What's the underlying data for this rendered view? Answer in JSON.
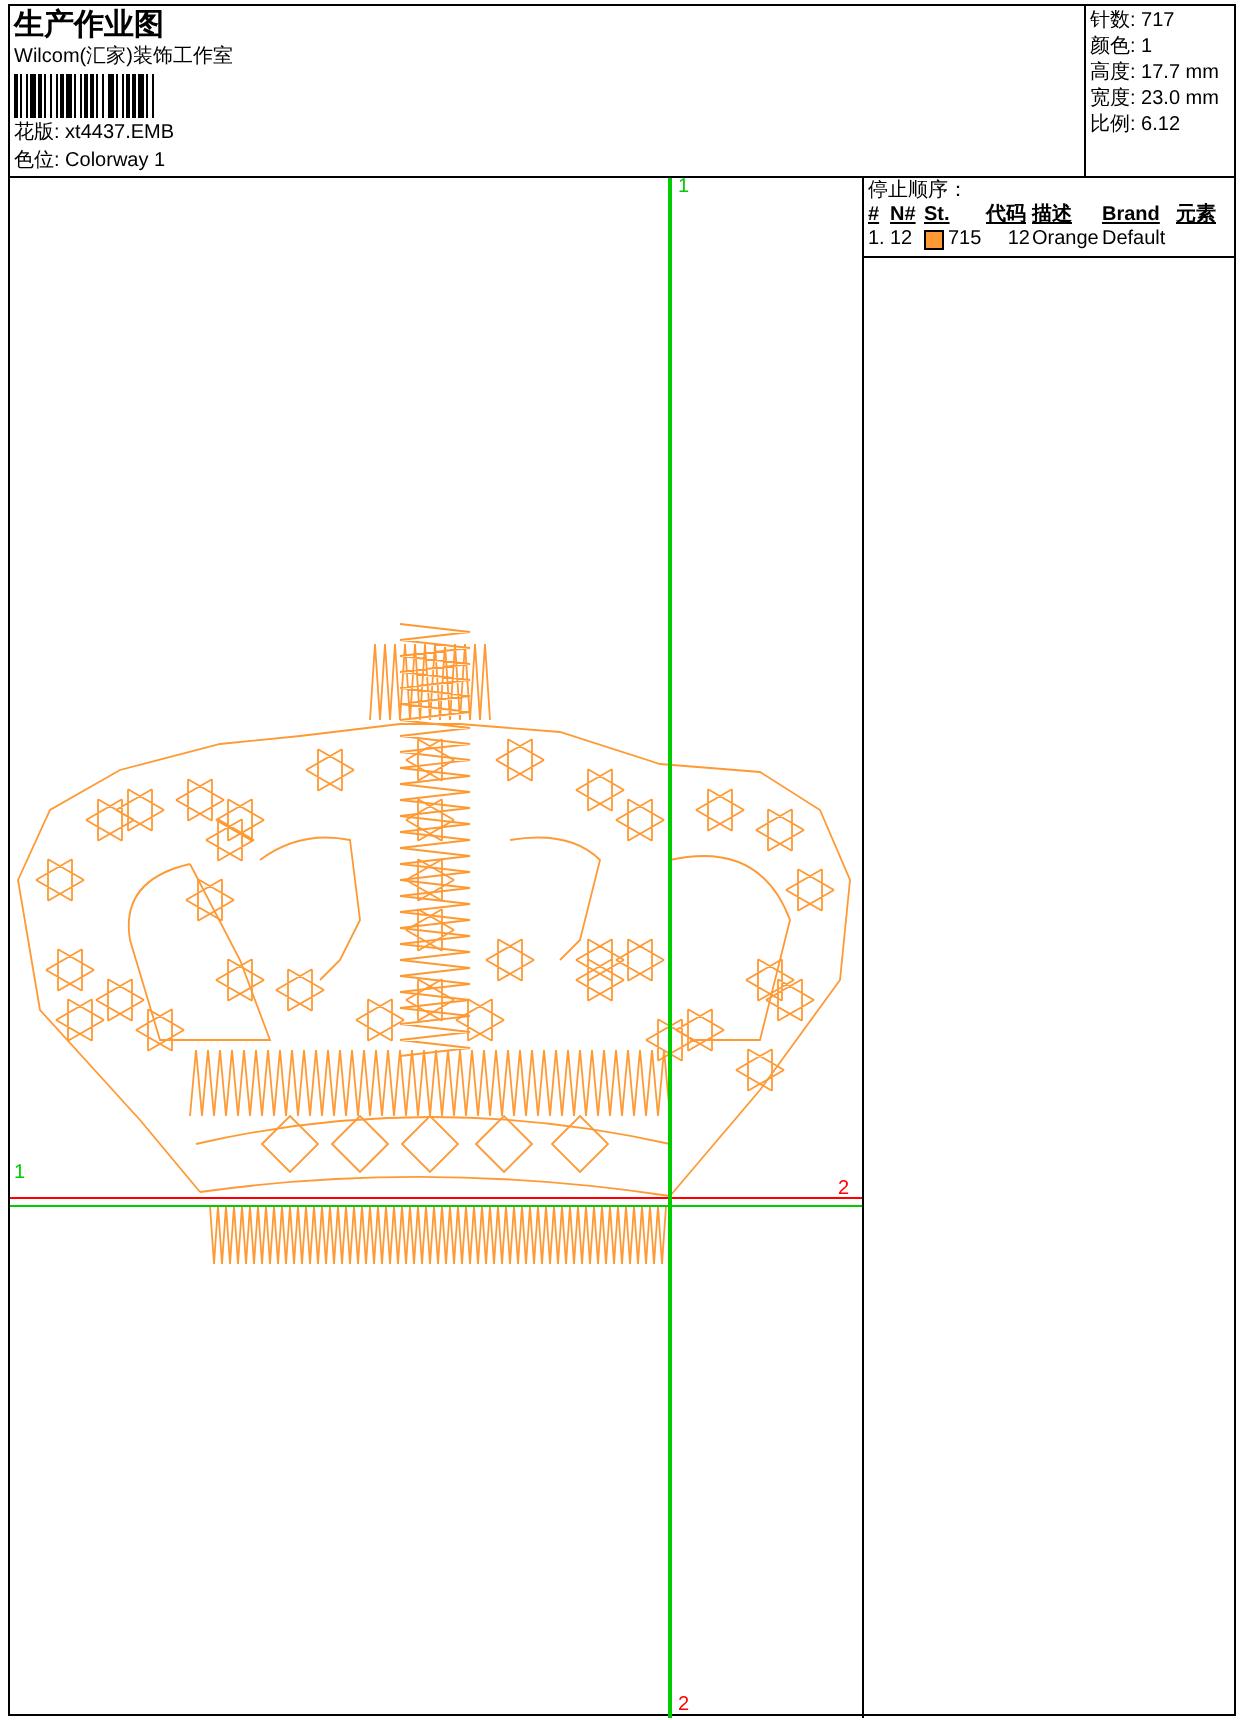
{
  "header": {
    "title": "生产作业图",
    "company": "Wilcom(汇家)装饰工作室",
    "design": "花版: xt4437.EMB",
    "colorway": "色位: Colorway 1"
  },
  "stats": [
    "针数: 717",
    "颜色: 1",
    "高度: 17.7 mm",
    "宽度: 23.0 mm",
    "比例: 6.12"
  ],
  "stop_sequence": {
    "title": "停止顺序：",
    "columns": [
      "#",
      "N#",
      "St.",
      "代码",
      "描述",
      "Brand",
      "元素"
    ],
    "rows": [
      {
        "index": "1.",
        "needle": "12",
        "color": "#ff9933",
        "stitches": "715",
        "code": "12",
        "description": "Orange",
        "brand": "Default"
      }
    ]
  },
  "canvas": {
    "vertical_axis": {
      "top_label": "1",
      "bottom_label": "2"
    },
    "horizontal_axis": {
      "left_label": "1",
      "right_label": "2"
    }
  }
}
